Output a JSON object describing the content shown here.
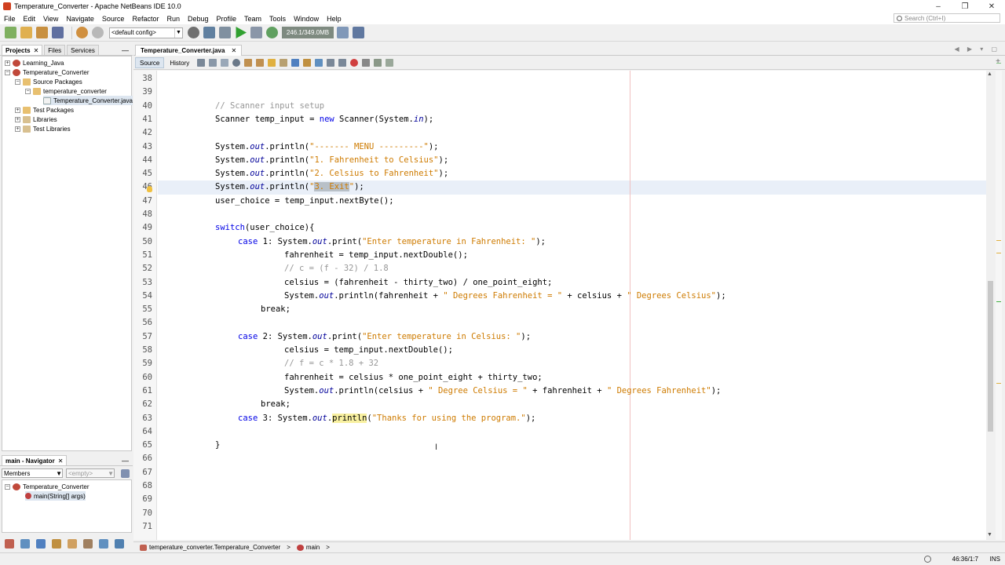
{
  "window": {
    "title": "Temperature_Converter - Apache NetBeans IDE 10.0",
    "controls": [
      "–",
      "❐",
      "✕"
    ]
  },
  "menu": [
    "File",
    "Edit",
    "View",
    "Navigate",
    "Source",
    "Refactor",
    "Run",
    "Debug",
    "Profile",
    "Team",
    "Tools",
    "Window",
    "Help"
  ],
  "search": {
    "placeholder": "Search (Ctrl+I)"
  },
  "toolbar": {
    "config": "<default config>",
    "memory": "246.1/349.0MB"
  },
  "projects_panel": {
    "tabs": [
      "Projects",
      "Files",
      "Services"
    ],
    "tree": [
      {
        "label": "Learning_Java",
        "expander": "+",
        "icon": "project"
      },
      {
        "label": "Temperature_Converter",
        "expander": "−",
        "icon": "project"
      },
      {
        "label": "Source Packages",
        "expander": "−",
        "icon": "package"
      },
      {
        "label": "temperature_converter",
        "expander": "−",
        "icon": "package"
      },
      {
        "label": "Temperature_Converter.java",
        "expander": "",
        "icon": "file"
      },
      {
        "label": "Test Packages",
        "expander": "+",
        "icon": "package"
      },
      {
        "label": "Libraries",
        "expander": "+",
        "icon": "library"
      },
      {
        "label": "Test Libraries",
        "expander": "+",
        "icon": "library"
      }
    ]
  },
  "navigator": {
    "title": "main - Navigator",
    "filter": "Members",
    "filter2": "<empty>",
    "tree": [
      {
        "label": "Temperature_Converter",
        "expander": "−"
      },
      {
        "label": "main(String[] args)",
        "expander": ""
      }
    ]
  },
  "editor": {
    "file_tab": "Temperature_Converter.java",
    "view_tabs": [
      "Source",
      "History"
    ],
    "line_numbers": [
      "38",
      "39",
      "40",
      "41",
      "42",
      "43",
      "44",
      "45",
      "46",
      "47",
      "48",
      "49",
      "50",
      "51",
      "52",
      "53",
      "54",
      "55",
      "56",
      "57",
      "58",
      "59",
      "60",
      "61",
      "62",
      "63",
      "64",
      "65",
      "66",
      "67",
      "68",
      "69",
      "70",
      "71"
    ],
    "code": {
      "l40": "// Scanner input setup",
      "l41a": "Scanner temp_input = ",
      "l41kw": "new",
      "l41b": " Scanner(System.",
      "l41it": "in",
      "l41c": ");",
      "l43a": "System.",
      "l43it": "out",
      "l43b": ".println(",
      "l43s": "\"------- MENU ---------\"",
      "l43c": ");",
      "l44a": "System.",
      "l44it": "out",
      "l44b": ".println(",
      "l44s": "\"1. Fahrenheit to Celsius\"",
      "l44c": ");",
      "l45a": "System.",
      "l45it": "out",
      "l45b": ".println(",
      "l45s": "\"2. Celsius to Fahrenheit\"",
      "l45c": ");",
      "l46a": "System.",
      "l46it": "out",
      "l46b": ".println(",
      "l46q": "\"",
      "l46sel": "3. Exit",
      "l46q2": "\"",
      "l46c": ");",
      "l47": "user_choice = temp_input.nextByte();",
      "l49kw": "switch",
      "l49b": "(user_choice){",
      "l50kw": "case",
      "l50a": " 1: System.",
      "l50it": "out",
      "l50b": ".print(",
      "l50s": "\"Enter temperature in Fahrenheit: \"",
      "l50c": ");",
      "l51": "fahrenheit = temp_input.nextDouble();",
      "l52": "// c = (f - 32) / 1.8",
      "l53": "celsius = (fahrenheit - thirty_two) / one_point_eight;",
      "l54a": "System.",
      "l54it": "out",
      "l54b": ".println(fahrenheit + ",
      "l54s1": "\" Degrees Fahrenheit = \"",
      "l54c": " + celsius + ",
      "l54s2": "\" Degrees Celsius\"",
      "l54d": ");",
      "l55": "break;",
      "l57kw": "case",
      "l57a": " 2: System.",
      "l57it": "out",
      "l57b": ".print(",
      "l57s": "\"Enter temperature in Celsius: \"",
      "l57c": ");",
      "l58": "celsius = temp_input.nextDouble();",
      "l59": "// f = c * 1.8 + 32",
      "l60": "fahrenheit = celsius * one_point_eight + thirty_two;",
      "l61a": "System.",
      "l61it": "out",
      "l61b": ".println(celsius + ",
      "l61s1": "\" Degree Celsius = \"",
      "l61c": " + fahrenheit + ",
      "l61s2": "\" Degrees Fahrenheit\"",
      "l61d": ");",
      "l62": "break;",
      "l63kw": "case",
      "l63a": " 3: System.",
      "l63it": "out",
      "l63b": ".",
      "l63hl": "println",
      "l63c": "(",
      "l63s": "\"Thanks for using the program.\"",
      "l63d": ");",
      "l65": "}"
    }
  },
  "breadcrumb": [
    "temperature_converter.Temperature_Converter",
    "main"
  ],
  "status": {
    "position": "46:36/1:7",
    "mode": "INS"
  },
  "colors": {
    "keyword": "#0000e6",
    "string": "#ce7b00",
    "comment": "#969696",
    "field": "#000099"
  }
}
